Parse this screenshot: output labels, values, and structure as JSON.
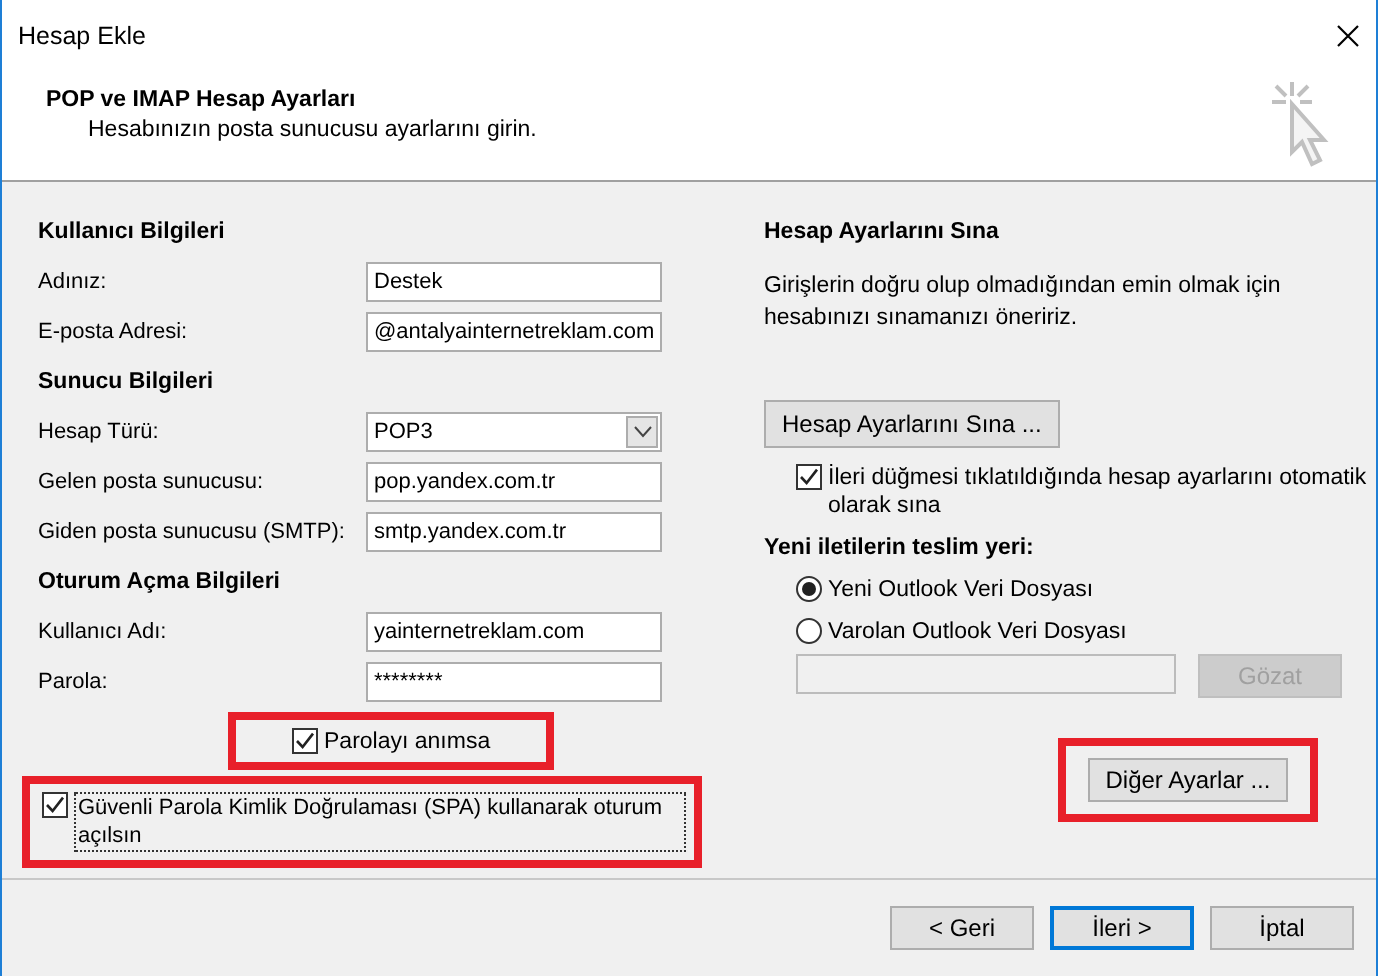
{
  "window": {
    "title": "Hesap Ekle"
  },
  "header": {
    "title": "POP ve IMAP Hesap Ayarları",
    "subtitle": "Hesabınızın posta sunucusu ayarlarını girin."
  },
  "left": {
    "groups": [
      {
        "heading": "Kullanıcı Bilgileri",
        "fields": [
          {
            "label": "Adınız:",
            "value": "Destek",
            "kind": "text"
          },
          {
            "label": "E-posta Adresi:",
            "value": "@antalyainternetreklam.com",
            "kind": "text"
          }
        ]
      },
      {
        "heading": "Sunucu Bilgileri",
        "fields": [
          {
            "label": "Hesap Türü:",
            "value": "POP3",
            "kind": "select"
          },
          {
            "label": "Gelen posta sunucusu:",
            "value": "pop.yandex.com.tr",
            "kind": "text"
          },
          {
            "label": "Giden posta sunucusu (SMTP):",
            "value": "smtp.yandex.com.tr",
            "kind": "text"
          }
        ]
      },
      {
        "heading": "Oturum Açma Bilgileri",
        "fields": [
          {
            "label": "Kullanıcı Adı:",
            "value": "yainternetreklam.com",
            "kind": "text"
          },
          {
            "label": "Parola:",
            "value": "********",
            "kind": "text"
          }
        ]
      }
    ],
    "remember_password": {
      "label": "Parolayı anımsa",
      "checked": true,
      "highlighted": true
    },
    "spa": {
      "label": "Güvenli Parola Kimlik Doğrulaması (SPA) kullanarak oturum açılsın",
      "checked": true,
      "highlighted": true
    }
  },
  "right": {
    "heading": "Hesap Ayarlarını Sına",
    "description": "Girişlerin doğru olup olmadığından emin olmak için hesabınızı sınamanızı öneririz.",
    "test_button": {
      "label": "Hesap Ayarlarını Sına ..."
    },
    "auto_test": {
      "label": "İleri düğmesi tıklatıldığında hesap ayarlarını otomatik olarak sına",
      "checked": true
    },
    "delivery_heading": "Yeni iletilerin teslim yeri:",
    "delivery_options": [
      {
        "label": "Yeni Outlook Veri Dosyası",
        "selected": true
      },
      {
        "label": "Varolan Outlook Veri Dosyası",
        "selected": false
      }
    ],
    "browse_button": {
      "label": "Gözat",
      "disabled": true
    },
    "more_settings_button": {
      "label": "Diğer Ayarlar ...",
      "highlighted": true
    }
  },
  "footer": {
    "buttons": [
      {
        "label": "< Geri",
        "default": false
      },
      {
        "label": "İleri >",
        "default": true
      },
      {
        "label": "İptal",
        "default": false
      }
    ]
  }
}
